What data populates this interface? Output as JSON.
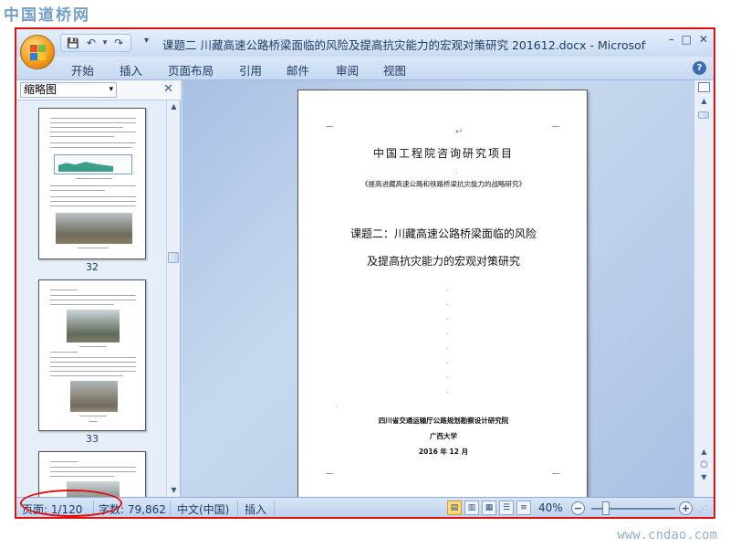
{
  "watermark": {
    "top": "中国道桥网",
    "bottom": "www.cndao.com"
  },
  "window": {
    "title": "课题二 川藏高速公路桥梁面临的风险及提高抗灾能力的宏观对策研究 201612.docx - Microsoft ...",
    "controls": {
      "minimize": "–",
      "maximize": "□",
      "close": "✕"
    }
  },
  "quick_access": {
    "save": "💾",
    "undo": "↶",
    "undo_dropdown": "▾",
    "redo": "↷",
    "more": "▾"
  },
  "ribbon": {
    "tabs": [
      "开始",
      "插入",
      "页面布局",
      "引用",
      "邮件",
      "审阅",
      "视图"
    ],
    "help": "?"
  },
  "thumbnail_pane": {
    "title": "缩略图",
    "dropdown_arrow": "▾",
    "close": "✕",
    "pages": [
      "32",
      "33"
    ]
  },
  "document": {
    "lines": [
      "中国工程院咨询研究项目",
      "《提高进藏高速公路和铁路桥梁抗灾能力的战略研究》",
      "课题二：川藏高速公路桥梁面临的风险",
      "及提高抗灾能力的宏观对策研究",
      "四川省交通运输厅公路规划勘察设计研究院",
      "广西大学",
      "2016 年 12 月"
    ]
  },
  "statusbar": {
    "page": "页面: 1/120",
    "words": "字数: 79,862",
    "language": "中文(中国)",
    "mode": "插入",
    "zoom": "40%",
    "zoom_out": "−",
    "zoom_in": "+",
    "zoom_level": 0.4
  },
  "colors": {
    "highlight": "#e01010",
    "accent": "#1f3b63"
  }
}
